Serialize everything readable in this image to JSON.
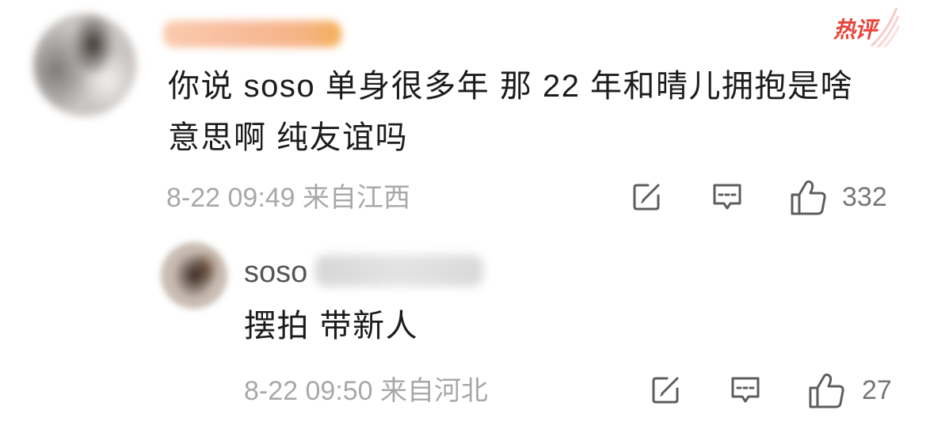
{
  "badge": {
    "label": "热评"
  },
  "comment": {
    "text_lines": [
      "你说 soso 单身很多年 那 22 年和晴儿拥抱是啥",
      "意思啊 纯友谊吗"
    ],
    "time": "8-22 09:49",
    "location": "来自江西",
    "like_count": "332"
  },
  "reply": {
    "author": "soso",
    "text": "摆拍 带新人",
    "time": "8-22 09:50",
    "location": "来自河北",
    "like_count": "27"
  },
  "icons": {
    "repost": "edit-share-icon",
    "comment": "comment-bubble-icon",
    "like": "thumbs-up-icon"
  },
  "colors": {
    "text": "#1c1c1c",
    "meta": "#a8a8a8",
    "icon": "#5d5d5d",
    "count": "#777777",
    "badge": "#e8443a",
    "username": "#555555"
  }
}
